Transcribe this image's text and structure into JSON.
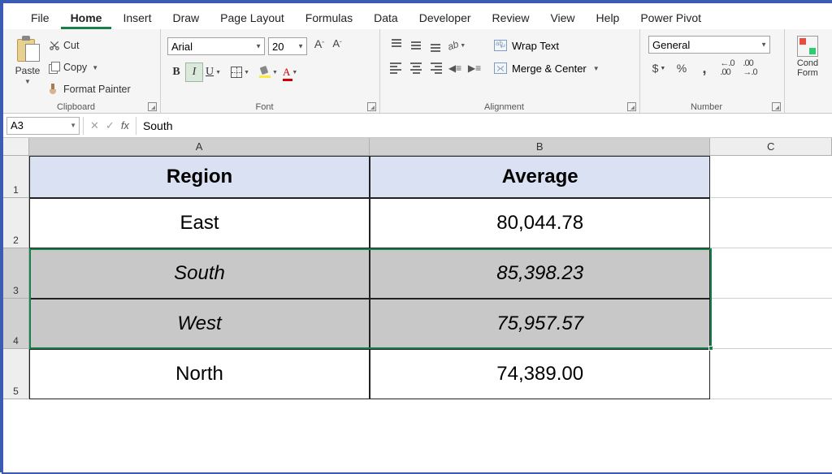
{
  "menu": {
    "tabs": [
      "File",
      "Home",
      "Insert",
      "Draw",
      "Page Layout",
      "Formulas",
      "Data",
      "Developer",
      "Review",
      "View",
      "Help",
      "Power Pivot"
    ],
    "active": "Home"
  },
  "ribbon": {
    "clipboard": {
      "group": "Clipboard",
      "paste": "Paste",
      "cut": "Cut",
      "copy": "Copy",
      "painter": "Format Painter"
    },
    "font": {
      "group": "Font",
      "name": "Arial",
      "size": "20",
      "bold": "B",
      "italic": "I",
      "underline": "U"
    },
    "alignment": {
      "group": "Alignment",
      "wrap": "Wrap Text",
      "merge": "Merge & Center"
    },
    "number": {
      "group": "Number",
      "format": "General",
      "currency": "$",
      "percent": "%",
      "comma": ","
    },
    "cond": {
      "l1": "Cond",
      "l2": "Form"
    }
  },
  "namebox": "A3",
  "formula": "South",
  "cols": {
    "A": "A",
    "B": "B",
    "C": "C"
  },
  "rows": {
    "1": "1",
    "2": "2",
    "3": "3",
    "4": "4",
    "5": "5"
  },
  "table": {
    "h1": "Region",
    "h2": "Average",
    "r1a": "East",
    "r1b": "80,044.78",
    "r2a": "South",
    "r2b": "85,398.23",
    "r3a": "West",
    "r3b": "75,957.57",
    "r4a": "North",
    "r4b": "74,389.00"
  },
  "chart_data": {
    "type": "table",
    "columns": [
      "Region",
      "Average"
    ],
    "rows": [
      {
        "Region": "East",
        "Average": 80044.78
      },
      {
        "Region": "South",
        "Average": 85398.23
      },
      {
        "Region": "West",
        "Average": 75957.57
      },
      {
        "Region": "North",
        "Average": 74389.0
      }
    ]
  }
}
